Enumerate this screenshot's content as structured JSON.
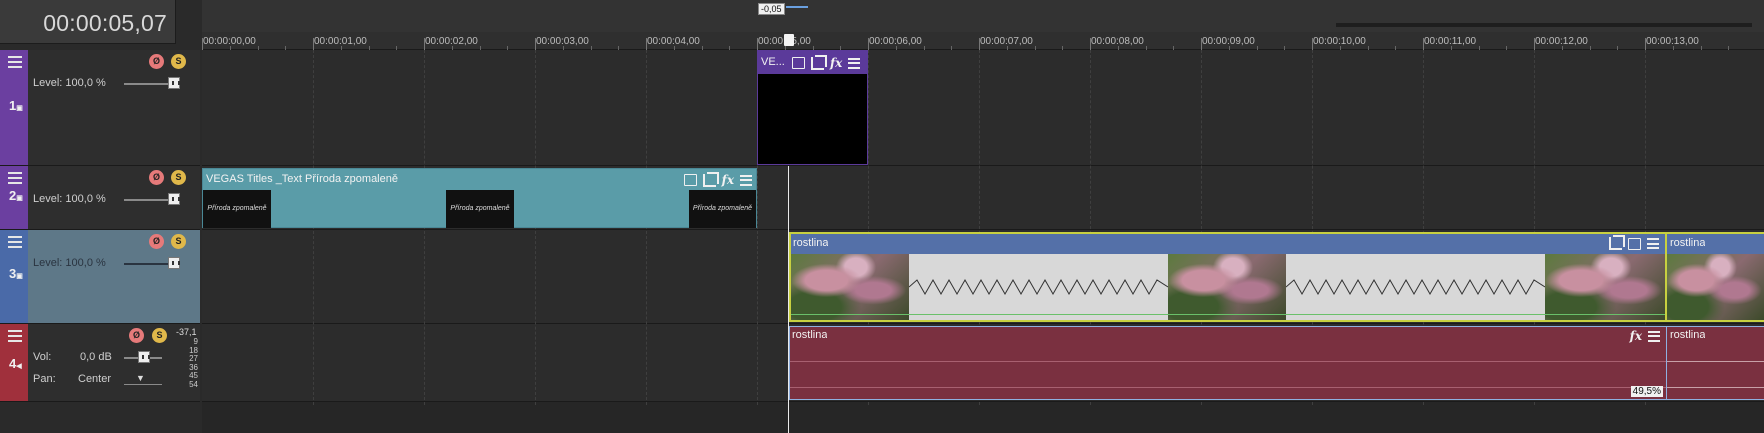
{
  "header": {
    "timecode": "00:00:05,07"
  },
  "ruler": {
    "ticks": [
      "00:00:00,00",
      "00:00:01,00",
      "00:00:02,00",
      "00:00:03,00",
      "00:00:04,00",
      "00:00:05,00",
      "00:00:06,00",
      "00:00:07,00",
      "00:00:08,00",
      "00:00:09,00",
      "00:00:10,00",
      "00:00:11,00",
      "00:00:12,00",
      "00:00:13,00"
    ],
    "offset_badge": "-0,05"
  },
  "tracks": [
    {
      "number": "1",
      "type": "video",
      "color": "#6b3fa0",
      "level_label": "Level:",
      "level_value": "100,0 %"
    },
    {
      "number": "2",
      "type": "video",
      "color": "#6b3fa0",
      "level_label": "Level:",
      "level_value": "100,0 %"
    },
    {
      "number": "3",
      "type": "video",
      "color": "#4a6aa8",
      "level_label": "Level:",
      "level_value": "100,0 %"
    },
    {
      "number": "4",
      "type": "audio",
      "color": "#a0303c",
      "vol_label": "Vol:",
      "vol_value": "0,0 dB",
      "pan_label": "Pan:",
      "pan_value": "Center",
      "meter_peak": "-37,1",
      "meter_scale": [
        "9",
        "18",
        "27",
        "36",
        "45",
        "54"
      ]
    }
  ],
  "events": {
    "track1_event": {
      "title": "VE..."
    },
    "track2_event": {
      "title": "VEGAS Titles _Text Příroda zpomaleně",
      "thumb_text": "Příroda zpomaleně"
    },
    "track3_event_a": {
      "title": "rostlina"
    },
    "track3_event_b": {
      "title": "rostlina"
    },
    "track4_event_a": {
      "title": "rostlina",
      "gain_badge": "49,5%"
    },
    "track4_event_b": {
      "title": "rostlina"
    }
  },
  "colors": {
    "track2_event": "#5a9ca8",
    "track3_event_header": "#5470a8",
    "track4_event": "#7a3040",
    "playhead": "#ffffff"
  }
}
